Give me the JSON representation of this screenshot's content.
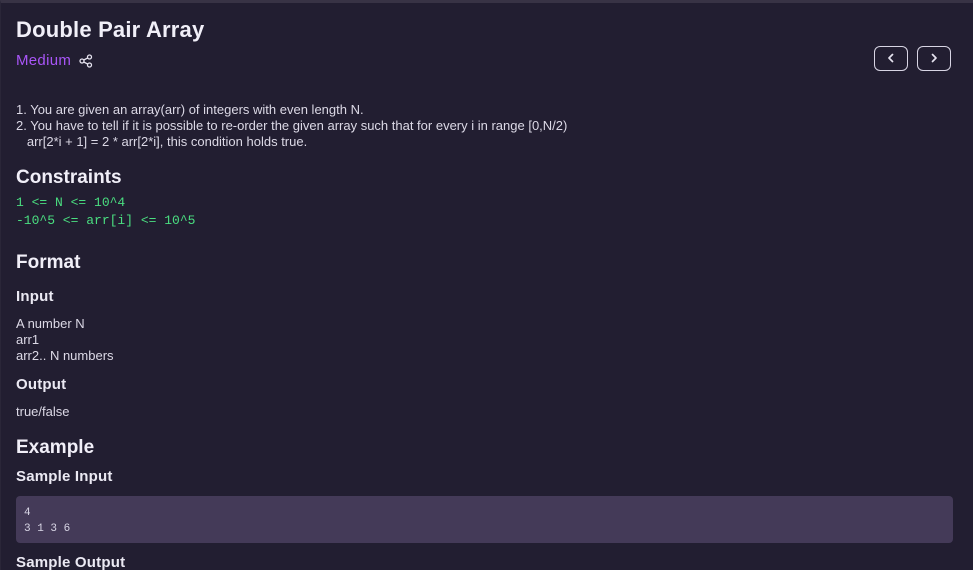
{
  "problem": {
    "title": "Double Pair Array",
    "difficulty": "Medium",
    "difficulty_color": "#a855f7",
    "description": [
      "1. You are given an array(arr) of integers with even length N.",
      "2. You have to tell if it is possible to re-order the given array such that for every i in range [0,N/2)",
      "   arr[2*i + 1] = 2 * arr[2*i], this condition holds true."
    ]
  },
  "icons": {
    "share": "share-icon",
    "prev": "chevron-left-icon",
    "next": "chevron-right-icon"
  },
  "constraints": {
    "heading": "Constraints",
    "lines": [
      "1 <= N <= 10^4",
      "-10^5 <= arr[i] <= 10^5"
    ],
    "color": "#4ade80"
  },
  "format": {
    "heading": "Format",
    "input_heading": "Input",
    "input_lines": [
      "A number N",
      "arr1",
      "arr2.. N numbers"
    ],
    "output_heading": "Output",
    "output_lines": [
      "true/false"
    ]
  },
  "example": {
    "heading": "Example",
    "sample_input_heading": "Sample Input",
    "sample_input_lines": [
      "4",
      "3 1 3 6"
    ],
    "sample_output_heading": "Sample Output"
  }
}
